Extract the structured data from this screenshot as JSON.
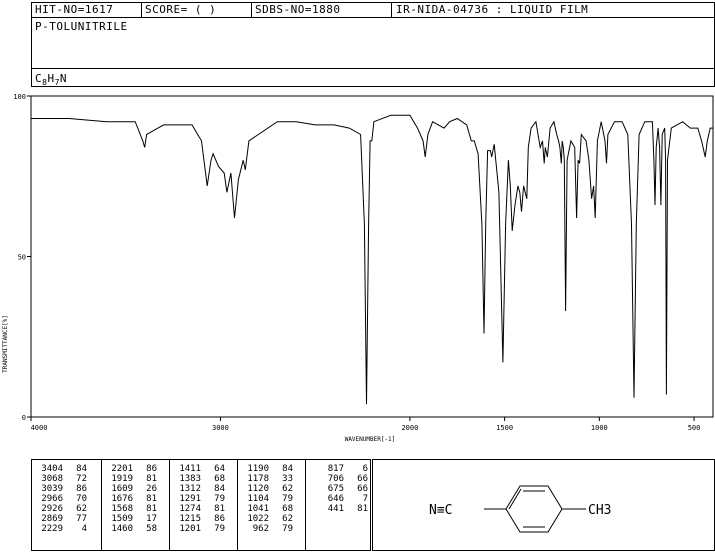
{
  "header": {
    "hit_no": "HIT-NO=1617",
    "score": "SCORE=  (   )",
    "sdbs_no": "SDBS-NO=1880",
    "ir_nida": "IR-NIDA-04736 : LIQUID FILM"
  },
  "compound": {
    "name": "P-TOLUNITRILE",
    "formula_c": "C",
    "formula_c_sub": "8",
    "formula_h": "H",
    "formula_h_sub": "7",
    "formula_n": "N"
  },
  "structure": {
    "left_group": "N≡C",
    "right_group": "CH3"
  },
  "peak_columns": [
    {
      "wn": [
        "3404",
        "3068",
        "3039",
        "2966",
        "2926",
        "2869",
        "2229"
      ],
      "t": [
        "84",
        "72",
        "86",
        "70",
        "62",
        "77",
        "4"
      ]
    },
    {
      "wn": [
        "2201",
        "1919",
        "1609",
        "1676",
        "1568",
        "1509",
        "1460"
      ],
      "t": [
        "86",
        "81",
        "26",
        "81",
        "81",
        "17",
        "58"
      ]
    },
    {
      "wn": [
        "1411",
        "1383",
        "1312",
        "1291",
        "1274",
        "1215",
        "1201"
      ],
      "t": [
        "64",
        "68",
        "84",
        "79",
        "81",
        "86",
        "79"
      ]
    },
    {
      "wn": [
        "1190",
        "1178",
        "1120",
        "1104",
        "1041",
        "1022",
        "962"
      ],
      "t": [
        "84",
        "33",
        "62",
        "79",
        "68",
        "62",
        "79"
      ]
    },
    {
      "wn": [
        "817",
        "706",
        "675",
        "646",
        "441"
      ],
      "t": [
        "6",
        "66",
        "66",
        "7",
        "81"
      ]
    }
  ],
  "chart_data": {
    "type": "line",
    "xlabel": "WAVENUMBER[-1]",
    "ylabel": "TRANSMITTANCE[%]",
    "xlim": [
      4000,
      400
    ],
    "ylim": [
      0,
      100
    ],
    "x_ticks": [
      4000,
      3000,
      2000,
      1500,
      1000,
      500
    ],
    "x_tick_labels": [
      "4000",
      "3000",
      "2000",
      "1500",
      "1000",
      "500"
    ],
    "y_ticks": [
      0,
      50,
      100
    ],
    "y_tick_labels": [
      "0",
      "50",
      "100"
    ],
    "grid": false,
    "series": [
      {
        "points": [
          [
            4000,
            93
          ],
          [
            3800,
            93
          ],
          [
            3600,
            92
          ],
          [
            3450,
            92
          ],
          [
            3410,
            86
          ],
          [
            3400,
            84
          ],
          [
            3390,
            88
          ],
          [
            3300,
            91
          ],
          [
            3150,
            91
          ],
          [
            3100,
            86
          ],
          [
            3070,
            72
          ],
          [
            3050,
            80
          ],
          [
            3039,
            82
          ],
          [
            3010,
            78
          ],
          [
            2980,
            76
          ],
          [
            2966,
            70
          ],
          [
            2945,
            76
          ],
          [
            2926,
            62
          ],
          [
            2905,
            74
          ],
          [
            2880,
            80
          ],
          [
            2869,
            77
          ],
          [
            2850,
            86
          ],
          [
            2700,
            92
          ],
          [
            2600,
            92
          ],
          [
            2500,
            91
          ],
          [
            2400,
            91
          ],
          [
            2320,
            90
          ],
          [
            2260,
            88
          ],
          [
            2240,
            60
          ],
          [
            2229,
            4
          ],
          [
            2218,
            60
          ],
          [
            2210,
            86
          ],
          [
            2201,
            86
          ],
          [
            2190,
            92
          ],
          [
            2100,
            94
          ],
          [
            2000,
            94
          ],
          [
            1960,
            90
          ],
          [
            1930,
            86
          ],
          [
            1919,
            81
          ],
          [
            1905,
            88
          ],
          [
            1880,
            92
          ],
          [
            1820,
            90
          ],
          [
            1790,
            92
          ],
          [
            1750,
            93
          ],
          [
            1700,
            91
          ],
          [
            1676,
            86
          ],
          [
            1660,
            86
          ],
          [
            1640,
            82
          ],
          [
            1620,
            60
          ],
          [
            1609,
            26
          ],
          [
            1600,
            60
          ],
          [
            1590,
            83
          ],
          [
            1575,
            83
          ],
          [
            1568,
            81
          ],
          [
            1555,
            85
          ],
          [
            1530,
            70
          ],
          [
            1509,
            17
          ],
          [
            1495,
            60
          ],
          [
            1480,
            80
          ],
          [
            1470,
            72
          ],
          [
            1460,
            58
          ],
          [
            1445,
            66
          ],
          [
            1430,
            72
          ],
          [
            1420,
            70
          ],
          [
            1411,
            64
          ],
          [
            1400,
            72
          ],
          [
            1383,
            68
          ],
          [
            1375,
            84
          ],
          [
            1360,
            90
          ],
          [
            1335,
            92
          ],
          [
            1312,
            84
          ],
          [
            1300,
            86
          ],
          [
            1291,
            79
          ],
          [
            1285,
            84
          ],
          [
            1274,
            81
          ],
          [
            1260,
            90
          ],
          [
            1240,
            92
          ],
          [
            1225,
            88
          ],
          [
            1215,
            86
          ],
          [
            1208,
            84
          ],
          [
            1201,
            79
          ],
          [
            1196,
            86
          ],
          [
            1190,
            84
          ],
          [
            1185,
            80
          ],
          [
            1178,
            33
          ],
          [
            1170,
            80
          ],
          [
            1150,
            86
          ],
          [
            1130,
            84
          ],
          [
            1120,
            62
          ],
          [
            1112,
            80
          ],
          [
            1104,
            79
          ],
          [
            1095,
            88
          ],
          [
            1070,
            86
          ],
          [
            1055,
            80
          ],
          [
            1041,
            68
          ],
          [
            1030,
            72
          ],
          [
            1022,
            62
          ],
          [
            1010,
            86
          ],
          [
            990,
            92
          ],
          [
            970,
            86
          ],
          [
            962,
            79
          ],
          [
            955,
            88
          ],
          [
            920,
            92
          ],
          [
            880,
            92
          ],
          [
            850,
            88
          ],
          [
            830,
            60
          ],
          [
            817,
            6
          ],
          [
            805,
            60
          ],
          [
            790,
            88
          ],
          [
            760,
            92
          ],
          [
            720,
            92
          ],
          [
            712,
            80
          ],
          [
            706,
            66
          ],
          [
            700,
            84
          ],
          [
            690,
            90
          ],
          [
            682,
            84
          ],
          [
            675,
            66
          ],
          [
            668,
            88
          ],
          [
            655,
            90
          ],
          [
            650,
            80
          ],
          [
            646,
            7
          ],
          [
            640,
            80
          ],
          [
            620,
            90
          ],
          [
            560,
            92
          ],
          [
            520,
            90
          ],
          [
            480,
            90
          ],
          [
            460,
            86
          ],
          [
            441,
            81
          ],
          [
            430,
            86
          ],
          [
            415,
            90
          ],
          [
            400,
            90
          ]
        ]
      }
    ]
  }
}
